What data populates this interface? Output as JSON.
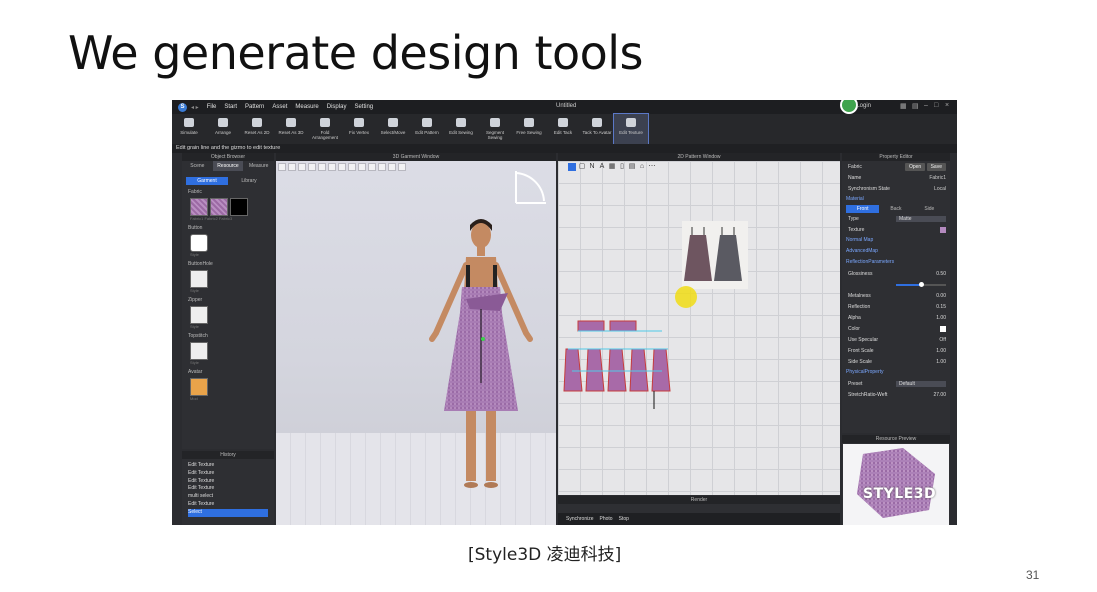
{
  "slide": {
    "title_regular": "We generate ",
    "title_bold": "design tools",
    "caption": "[Style3D 凌迪科技]",
    "page_number": "31"
  },
  "app": {
    "window_title": "Untitled",
    "login_label": "Login",
    "logo_letter": "S",
    "menu": [
      "File",
      "Start",
      "Pattern",
      "Asset",
      "Measure",
      "Display",
      "Setting"
    ],
    "toolbar": [
      {
        "label": "Simulate",
        "icon": "simulate-icon"
      },
      {
        "label": "Arrange",
        "icon": "arrange-icon"
      },
      {
        "label": "Reset As 2D",
        "icon": "reset-2d-icon"
      },
      {
        "label": "Reset As 3D",
        "icon": "reset-3d-icon"
      },
      {
        "label": "Fold Arrangement",
        "icon": "fold-icon"
      },
      {
        "label": "Fix Vertex",
        "icon": "fix-vertex-icon"
      },
      {
        "label": "Select/Move",
        "icon": "select-icon"
      },
      {
        "label": "Edit Pattern",
        "icon": "edit-pattern-icon"
      },
      {
        "label": "Edit Sewing",
        "icon": "edit-sewing-icon"
      },
      {
        "label": "Segment Sewing",
        "icon": "segment-sewing-icon"
      },
      {
        "label": "Free Sewing",
        "icon": "free-sewing-icon"
      },
      {
        "label": "Edit Tack",
        "icon": "edit-tack-icon"
      },
      {
        "label": "Tack To Avatar",
        "icon": "tack-avatar-icon"
      },
      {
        "label": "Edit Texture",
        "icon": "edit-texture-icon"
      }
    ],
    "status_text": "Edit grain line and the gizmo to edit texture",
    "object_browser": {
      "title": "Object Browser",
      "tabs": [
        "Scene",
        "Resource",
        "Measure"
      ],
      "subtabs": [
        "Garment",
        "Library"
      ],
      "categories": [
        "Fabric",
        "Button",
        "ButtonHole",
        "Zipper",
        "Topstitch",
        "Avatar"
      ],
      "fabric_labels": "Fabric1  Fabric2  Fabric3",
      "item_label": "Style",
      "avatar_label": "Mod"
    },
    "history": {
      "title": "History",
      "items": [
        "Edit Texture",
        "Edit Texture",
        "Edit Texture",
        "Edit Texture",
        "multi select",
        "Edit Texture",
        "Select"
      ]
    },
    "garment_window_title": "3D Garment Window",
    "pattern_window_title": "2D Pattern Window",
    "render": {
      "title": "Render",
      "buttons": [
        "Synchronize",
        "Photo",
        "Stop"
      ]
    },
    "property_editor": {
      "title": "Property Editor",
      "fabric_label": "Fabric",
      "open": "Open",
      "save": "Save",
      "name_label": "Name",
      "name_value": "Fabric1",
      "sync_label": "Synchronism State",
      "sync_value": "Local",
      "material_label": "Material",
      "sides": [
        "Front",
        "Back",
        "Side"
      ],
      "type_label": "Type",
      "type_value": "Matte",
      "texture_label": "Texture",
      "normal_map": "Normal Map",
      "advanced_map": "AdvancedMap",
      "reflection_params": "ReflectionParameters",
      "glossiness": {
        "label": "Glossiness",
        "value": "0.50"
      },
      "metalness": {
        "label": "Metalness",
        "value": "0.00"
      },
      "reflection": {
        "label": "Reflection",
        "value": "0.15"
      },
      "alpha": {
        "label": "Alpha",
        "value": "1.00"
      },
      "color_label": "Color",
      "use_specular": "Use Specular",
      "specular_state": "Off",
      "front_scale": {
        "label": "Front Scale",
        "value": "1.00"
      },
      "side_scale": {
        "label": "Side Scale",
        "value": "1.00"
      },
      "physical_property": "PhysicalProperty",
      "preset_label": "Preset",
      "preset_value": "Default",
      "stretch_label": "StretchRatio-Weft",
      "stretch_value": "27.00"
    },
    "resource_preview": {
      "title": "Resource Preview",
      "brand": "STYLE3D"
    }
  }
}
